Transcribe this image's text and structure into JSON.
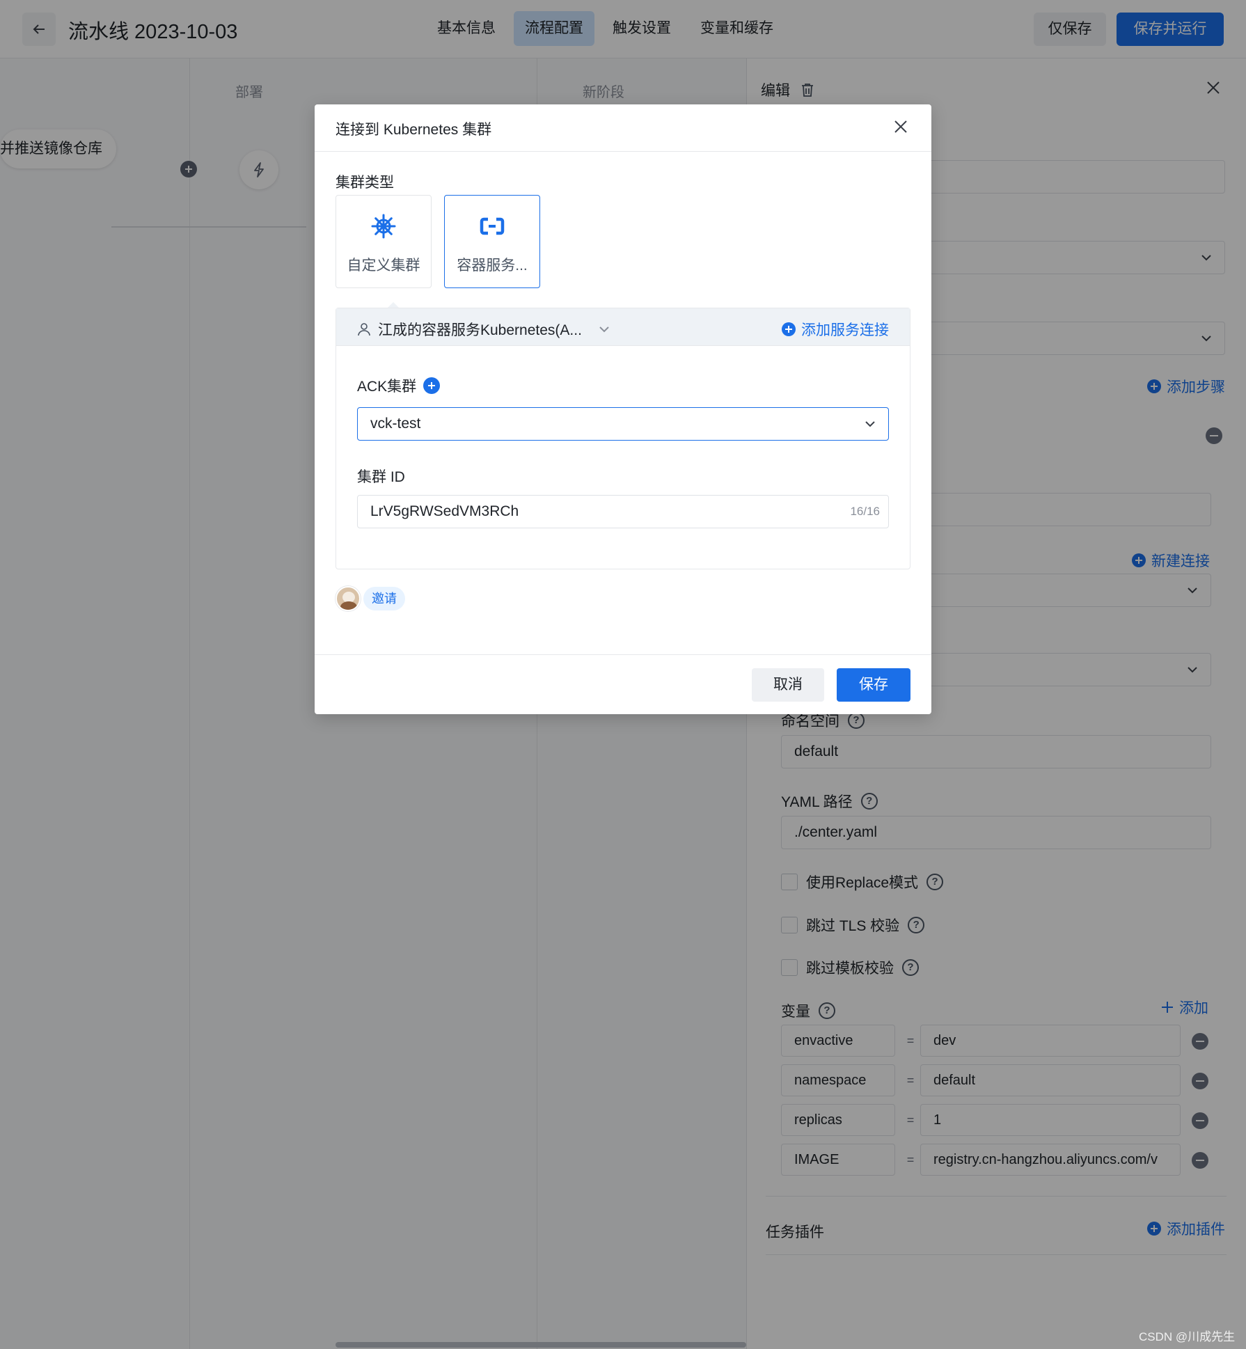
{
  "header": {
    "title": "流水线 2023-10-03",
    "tabs": [
      {
        "label": "基本信息",
        "active": false
      },
      {
        "label": "流程配置",
        "active": true
      },
      {
        "label": "触发设置",
        "active": false
      },
      {
        "label": "变量和缓存",
        "active": false
      }
    ],
    "save_only": "仅保存",
    "save_run": "保存并运行"
  },
  "canvas": {
    "stages": [
      "部署",
      "新阶段"
    ],
    "job_label": "并推送镜像仓库"
  },
  "panel": {
    "title": "编辑",
    "add_step": "添加步骤",
    "new_connection": "新建连接",
    "namespace_label": "命名空间",
    "namespace_value": "default",
    "yaml_label": "YAML 路径",
    "yaml_value": "./center.yaml",
    "options": [
      "使用Replace模式",
      "跳过 TLS 校验",
      "跳过模板校验"
    ],
    "variables_label": "变量",
    "add_label": "添加",
    "variables": [
      {
        "key": "envactive",
        "value": "dev"
      },
      {
        "key": "namespace",
        "value": "default"
      },
      {
        "key": "replicas",
        "value": "1"
      },
      {
        "key": "IMAGE",
        "value": "registry.cn-hangzhou.aliyuncs.com/v"
      }
    ],
    "plugins_label": "任务插件",
    "add_plugin": "添加插件"
  },
  "modal": {
    "title": "连接到 Kubernetes 集群",
    "cluster_type_label": "集群类型",
    "cluster_types": [
      {
        "label": "自定义集群",
        "icon": "kubernetes-helm-icon",
        "selected": false
      },
      {
        "label": "容器服务...",
        "icon": "aliyun-icon",
        "selected": true
      }
    ],
    "connection_name": "江成的容器服务Kubernetes(A...",
    "add_connection": "添加服务连接",
    "ack_label": "ACK集群",
    "ack_value": "vck-test",
    "cluster_id_label": "集群 ID",
    "cluster_id_value": "LrV5gRWSedVM3RCh",
    "cluster_id_count": "16/16",
    "invite": "邀请",
    "cancel": "取消",
    "save": "保存"
  },
  "watermark": "CSDN @川成先生",
  "colors": {
    "accent": "#1b6fe8",
    "overlay": "rgba(0,0,0,0.40)"
  }
}
